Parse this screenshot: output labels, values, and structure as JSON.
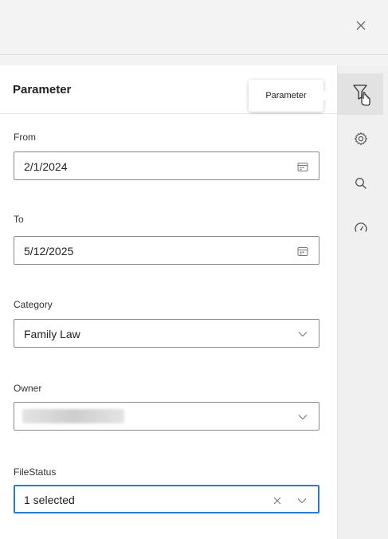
{
  "panel": {
    "title": "Parameter"
  },
  "tooltip": {
    "text": "Parameter"
  },
  "fields": {
    "from": {
      "label": "From",
      "value": "2/1/2024"
    },
    "to": {
      "label": "To",
      "value": "5/12/2025"
    },
    "category": {
      "label": "Category",
      "value": "Family Law"
    },
    "owner": {
      "label": "Owner",
      "value": ""
    },
    "file_status": {
      "label": "FileStatus",
      "value": "1 selected"
    }
  },
  "icons": {
    "close": "close-icon",
    "rail": [
      "filter-icon",
      "settings-gear-icon",
      "search-icon",
      "gauge-icon"
    ],
    "calendar": "calendar-icon",
    "dropdown": "chevron-down-icon"
  },
  "colors": {
    "focus_border": "#2b7bd1",
    "rail_bg": "#f0f0f0",
    "active_rail_bg": "#e2e2e2"
  }
}
